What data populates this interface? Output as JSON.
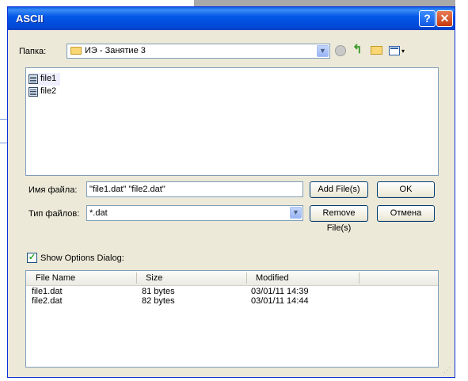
{
  "window": {
    "title": "ASCII",
    "help_label": "?",
    "close_label": "✕"
  },
  "folder": {
    "label": "Папка:",
    "value": "ИЭ - Занятие 3"
  },
  "toolbar_icons": [
    "back-icon",
    "up-folder-icon",
    "new-folder-icon",
    "view-menu-icon"
  ],
  "files": [
    {
      "name": "file1"
    },
    {
      "name": "file2"
    }
  ],
  "filename": {
    "label": "Имя файла:",
    "value": "\"file1.dat\" \"file2.dat\""
  },
  "filetype": {
    "label": "Тип файлов:",
    "value": "*.dat"
  },
  "buttons": {
    "add": "Add File(s)",
    "ok": "OK",
    "remove": "Remove File(s)",
    "cancel": "Отмена"
  },
  "options": {
    "label": "Show Options Dialog:",
    "checked": true
  },
  "selected_table": {
    "headers": [
      "File Name",
      "Size",
      "Modified"
    ],
    "rows": [
      {
        "name": "file1.dat",
        "size": "81 bytes",
        "modified": "03/01/11 14:39"
      },
      {
        "name": "file2.dat",
        "size": "82 bytes",
        "modified": "03/01/11 14:44"
      }
    ]
  }
}
